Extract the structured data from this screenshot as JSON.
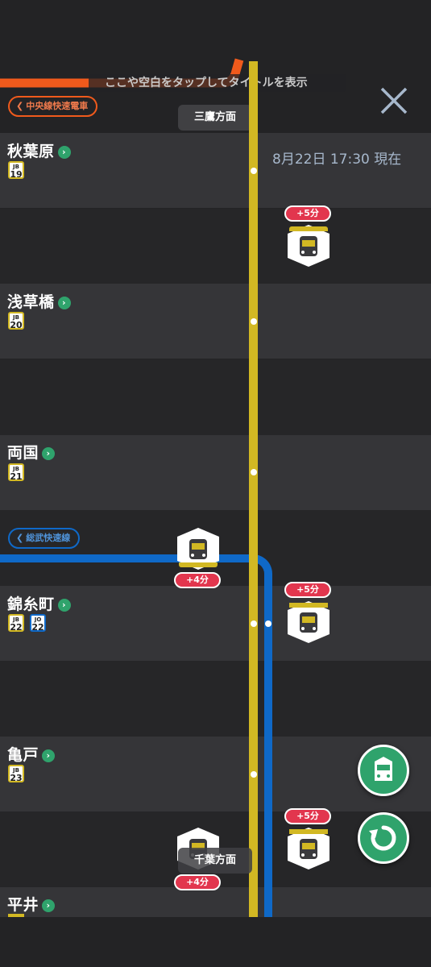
{
  "header": {
    "tap_hint": "ここや空白をタップしてタイトルを表示",
    "close_icon": "close-icon",
    "timestamp": "8月22日 17:30 現在"
  },
  "lines": {
    "chuo": {
      "label": "中央線快速電車",
      "color": "#f05a1c"
    },
    "sobu": {
      "label": "総武快速線",
      "color": "#0f69c8"
    },
    "main_color": "#d2b823"
  },
  "directions": {
    "up": "三鷹方面",
    "down": "千葉方面"
  },
  "stations": [
    {
      "name": "秋葉原",
      "badges": [
        {
          "line": "JB",
          "num": "19"
        }
      ]
    },
    {
      "name": "浅草橋",
      "badges": [
        {
          "line": "JB",
          "num": "20"
        }
      ]
    },
    {
      "name": "両国",
      "badges": [
        {
          "line": "JB",
          "num": "21"
        }
      ]
    },
    {
      "name": "錦糸町",
      "badges": [
        {
          "line": "JB",
          "num": "22"
        },
        {
          "line": "JO",
          "num": "22"
        }
      ]
    },
    {
      "name": "亀戸",
      "badges": [
        {
          "line": "JB",
          "num": "23"
        }
      ]
    },
    {
      "name": "平井",
      "badges": []
    }
  ],
  "trains": [
    {
      "delay": "+5分"
    },
    {
      "delay": "+4分"
    },
    {
      "delay": "+5分"
    },
    {
      "delay": "+5分"
    },
    {
      "delay": "+4分"
    }
  ],
  "fabs": {
    "train_icon": "train-icon",
    "refresh_icon": "refresh-icon"
  }
}
